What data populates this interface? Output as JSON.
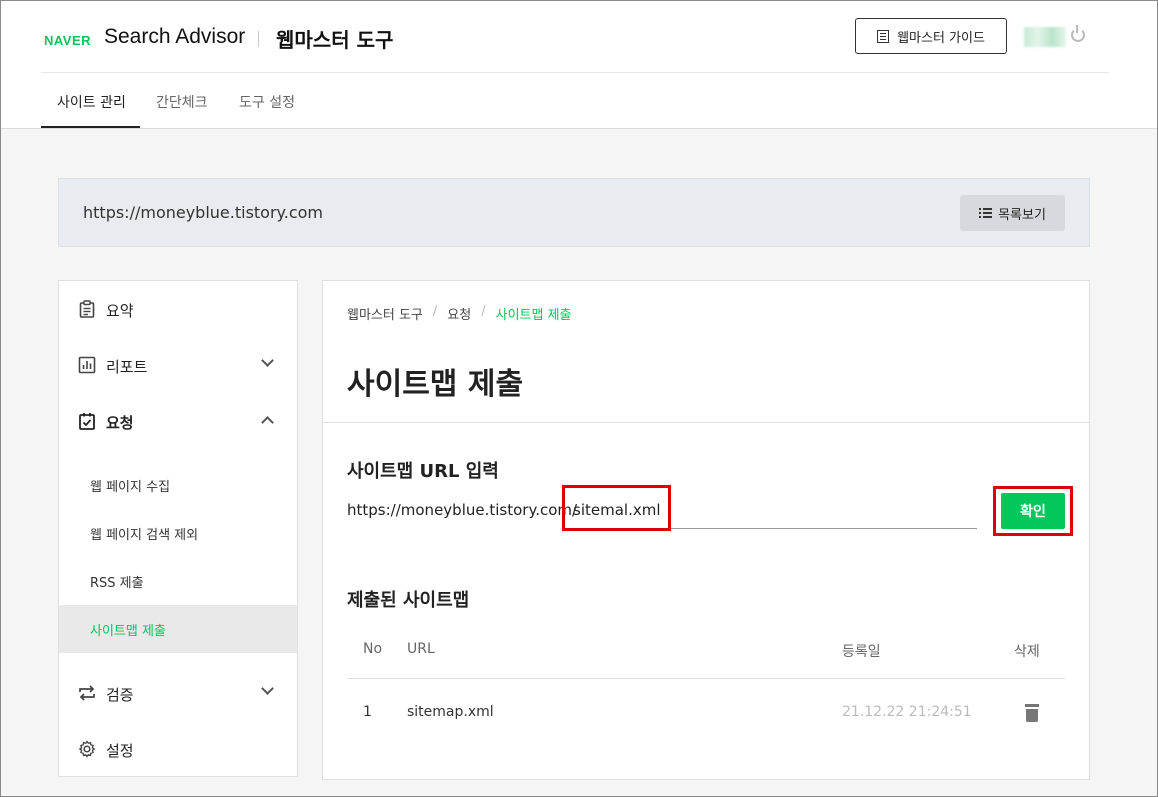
{
  "header": {
    "naver_logo": "NAVER",
    "app_name": "Search Advisor",
    "section_title": "웹마스터 도구",
    "guide_button": "웹마스터 가이드"
  },
  "nav": {
    "tabs": [
      {
        "label": "사이트 관리",
        "active": true
      },
      {
        "label": "간단체크",
        "active": false
      },
      {
        "label": "도구 설정",
        "active": false
      }
    ]
  },
  "site_bar": {
    "url": "https://moneyblue.tistory.com",
    "list_button": "목록보기"
  },
  "sidebar": {
    "items": [
      {
        "label": "요약",
        "icon": "clipboard-icon"
      },
      {
        "label": "리포트",
        "icon": "chart-icon",
        "expandable": true
      },
      {
        "label": "요청",
        "icon": "checklist-icon",
        "expanded": true
      },
      {
        "label": "검증",
        "icon": "repeat-icon",
        "expandable": true
      },
      {
        "label": "설정",
        "icon": "gear-icon"
      }
    ],
    "sub_items": [
      {
        "label": "웹 페이지 수집"
      },
      {
        "label": "웹 페이지 검색 제외"
      },
      {
        "label": "RSS 제출"
      },
      {
        "label": "사이트맵 제출",
        "active": true
      }
    ]
  },
  "main": {
    "breadcrumb": [
      "웹마스터 도구",
      "요청",
      "사이트맵 제출"
    ],
    "title": "사이트맵 제출",
    "input_section_title": "사이트맵 URL 입력",
    "url_prefix": "https://moneyblue.tistory.com/",
    "input_value": "sitemal.xml",
    "confirm_button": "확인",
    "submitted_title": "제출된 사이트맵",
    "table": {
      "headers": {
        "no": "No",
        "url": "URL",
        "date": "등록일",
        "delete": "삭제"
      },
      "rows": [
        {
          "no": "1",
          "url": "sitemap.xml",
          "date": "21.12.22 21:24:51"
        }
      ]
    }
  },
  "colors": {
    "accent": "#03c75a",
    "highlight": "#e00000"
  }
}
